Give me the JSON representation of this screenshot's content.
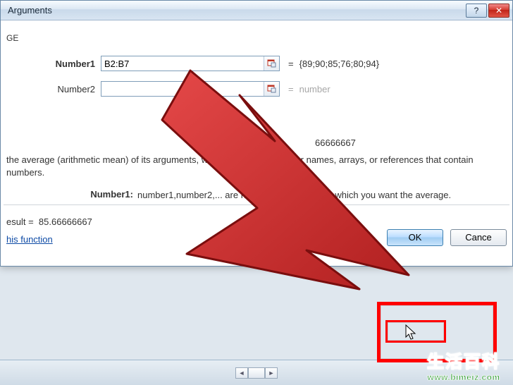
{
  "dialog": {
    "title": "Arguments",
    "functionName": "GE",
    "args": [
      {
        "label": "Number1",
        "value": "B2:B7",
        "preview": "{89;90;85;76;80;94}",
        "bold": true,
        "dim": false
      },
      {
        "label": "Number2",
        "value": "",
        "preview": "number",
        "bold": false,
        "dim": true
      }
    ],
    "intermediateResultLabel": "66666667",
    "description": "the average (arithmetic mean) of its arguments, which can be numbers or names, arrays, or references that contain numbers.",
    "argHelp": {
      "label": "Number1:",
      "text": "number1,number2,... are numeric arguments for which you want the average."
    },
    "resultLabel": "esult  =",
    "resultValue": "85.66666667",
    "helpLinkText": "his function",
    "buttons": {
      "ok": "OK",
      "cancel": "Cance"
    }
  },
  "icons": {
    "help": "?",
    "close": "✕"
  },
  "watermark": {
    "text": "生活百科",
    "url": "www.bimeiz.com"
  }
}
